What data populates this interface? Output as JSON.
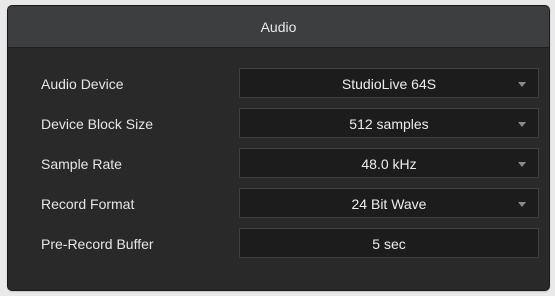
{
  "panel": {
    "title": "Audio"
  },
  "settings": [
    {
      "label": "Audio Device",
      "value": "StudioLive 64S",
      "dropdown": true
    },
    {
      "label": "Device Block Size",
      "value": "512 samples",
      "dropdown": true
    },
    {
      "label": "Sample Rate",
      "value": "48.0 kHz",
      "dropdown": true
    },
    {
      "label": "Record Format",
      "value": "24 Bit Wave",
      "dropdown": true
    },
    {
      "label": "Pre-Record Buffer",
      "value": "5 sec",
      "dropdown": false
    }
  ],
  "icons": {
    "dropdown": "chevron-down-icon"
  },
  "colors": {
    "panel_bg": "#29292a",
    "header_bg": "#3d3e40",
    "field_bg": "#1c1c1d",
    "text": "#e6e6e6"
  }
}
